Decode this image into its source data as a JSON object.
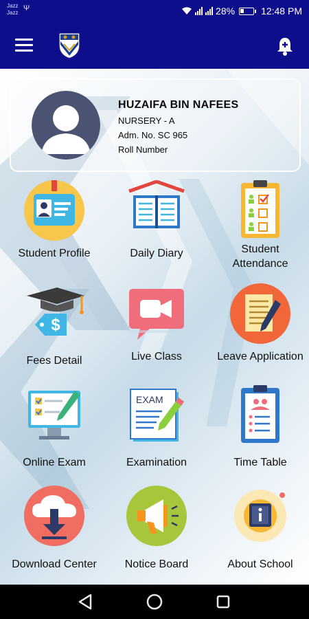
{
  "status_bar": {
    "carrier_line1": "Jazz",
    "carrier_line2": "Jazz",
    "battery_text": "28%",
    "battery_level": 0.28,
    "time": "12:48 PM"
  },
  "app_bar": {
    "menu_icon": "hamburger-menu-icon",
    "logo": "school-crest-logo",
    "notification_icon": "bell-add-icon"
  },
  "profile": {
    "name": "HUZAIFA BIN NAFEES",
    "class": "NURSERY - A",
    "admission": "Adm. No. SC 965",
    "roll": "Roll Number"
  },
  "menu": [
    {
      "label": "Student Profile",
      "icon": "id-card-icon"
    },
    {
      "label": "Daily Diary",
      "icon": "open-book-icon"
    },
    {
      "label": "Student Attendance",
      "icon": "attendance-clipboard-icon"
    },
    {
      "label": "Fees Detail",
      "icon": "graduation-fees-icon"
    },
    {
      "label": "Live Class",
      "icon": "video-camera-icon"
    },
    {
      "label": "Leave Application",
      "icon": "application-pen-icon"
    },
    {
      "label": "Online Exam",
      "icon": "computer-checklist-icon"
    },
    {
      "label": "Examination",
      "icon": "exam-paper-icon"
    },
    {
      "label": "Time Table",
      "icon": "timetable-clipboard-icon"
    },
    {
      "label": "Download Center",
      "icon": "cloud-download-icon"
    },
    {
      "label": "Notice Board",
      "icon": "megaphone-icon"
    },
    {
      "label": "About School",
      "icon": "info-icon"
    }
  ],
  "nav_bar": {
    "back_icon": "back-triangle-icon",
    "home_icon": "home-circle-icon",
    "recents_icon": "recents-square-icon"
  },
  "colors": {
    "header": "#0e0d8c",
    "accent_orange": "#f7941d",
    "accent_teal": "#3fb6e4"
  }
}
